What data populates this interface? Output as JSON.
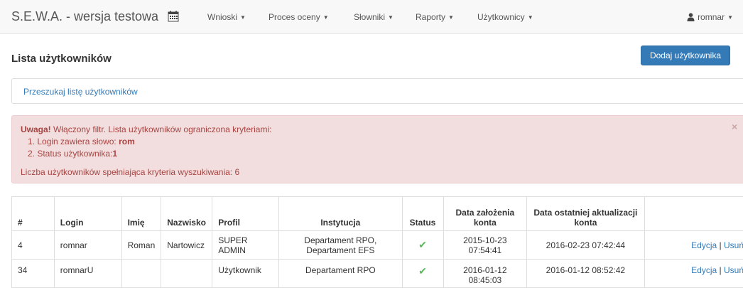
{
  "navbar": {
    "brand": "S.E.W.A. - wersja testowa",
    "menus": [
      {
        "label": "Wnioski"
      },
      {
        "label": "Proces oceny"
      },
      {
        "label": "Słowniki"
      },
      {
        "label": "Raporty"
      },
      {
        "label": "Użytkownicy"
      }
    ],
    "user": "romnar"
  },
  "page": {
    "title": "Lista użytkowników",
    "add_button": "Dodaj użytkownika"
  },
  "search": {
    "link": "Przeszukaj listę użytkowników"
  },
  "alert": {
    "strong": "Uwaga!",
    "text": " Włączony filtr. Lista użytkowników ograniczona kryteriami:",
    "criteria": [
      {
        "label": "1. Login zawiera słowo: ",
        "value": "rom"
      },
      {
        "label": "2. Status użytkownika:",
        "value": "1"
      }
    ],
    "count_text": "Liczba użytkowników spełniająca kryteria wyszukiwania: 6",
    "close": "×"
  },
  "table": {
    "headers": [
      "#",
      "Login",
      "Imię",
      "Nazwisko",
      "Profil",
      "Instytucja",
      "Status",
      "Data założenia konta",
      "Data ostatniej aktualizacji konta",
      ""
    ],
    "rows": [
      {
        "id": "4",
        "login": "romnar",
        "imie": "Roman",
        "nazwisko": "Nartowicz",
        "profil": "SUPER ADMIN",
        "instytucja": "Departament RPO, Departament EFS",
        "status": "✔",
        "created": "2015-10-23 07:54:41",
        "updated": "2016-02-23 07:42:44",
        "edit": "Edycja",
        "sep": "|",
        "delete": "Usuń"
      },
      {
        "id": "34",
        "login": "romnarU",
        "imie": "",
        "nazwisko": "",
        "profil": "Użytkownik",
        "instytucja": "Departament RPO",
        "status": "✔",
        "created": "2016-01-12 08:45:03",
        "updated": "2016-01-12 08:52:42",
        "edit": "Edycja",
        "sep": "|",
        "delete": "Usuń"
      }
    ]
  }
}
